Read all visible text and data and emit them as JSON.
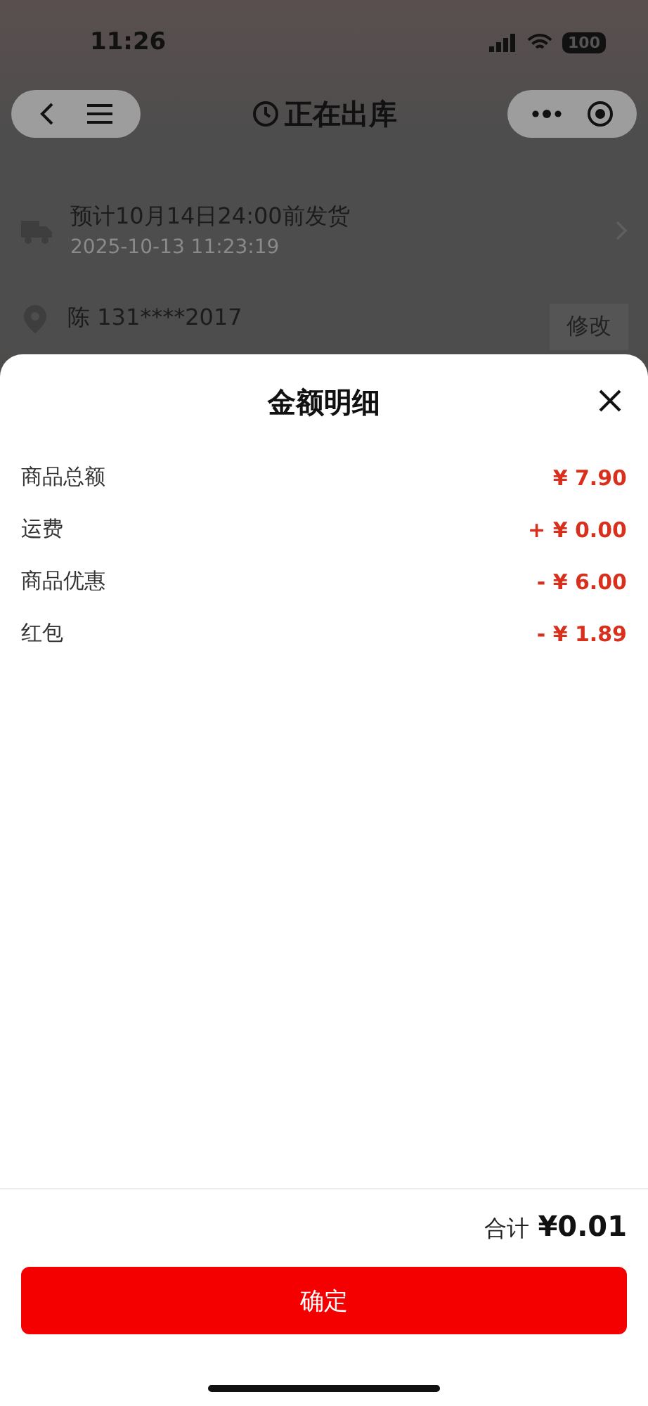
{
  "status_bar": {
    "time": "11:26",
    "battery": "100"
  },
  "nav": {
    "title": "正在出库"
  },
  "shipping": {
    "title": "预计10月14日24:00前发货",
    "time": "2025-10-13 11:23:19"
  },
  "address": {
    "contact": "陈 131****2017",
    "action": "修改"
  },
  "sheet": {
    "title": "金额明细",
    "rows": [
      {
        "label": "商品总额",
        "value": "¥ 7.90"
      },
      {
        "label": "运费",
        "value": "+ ¥ 0.00"
      },
      {
        "label": "商品优惠",
        "value": "- ¥ 6.00"
      },
      {
        "label": "红包",
        "value": "- ¥ 1.89"
      }
    ],
    "total_label": "合计",
    "total_value": "¥0.01",
    "confirm": "确定"
  }
}
